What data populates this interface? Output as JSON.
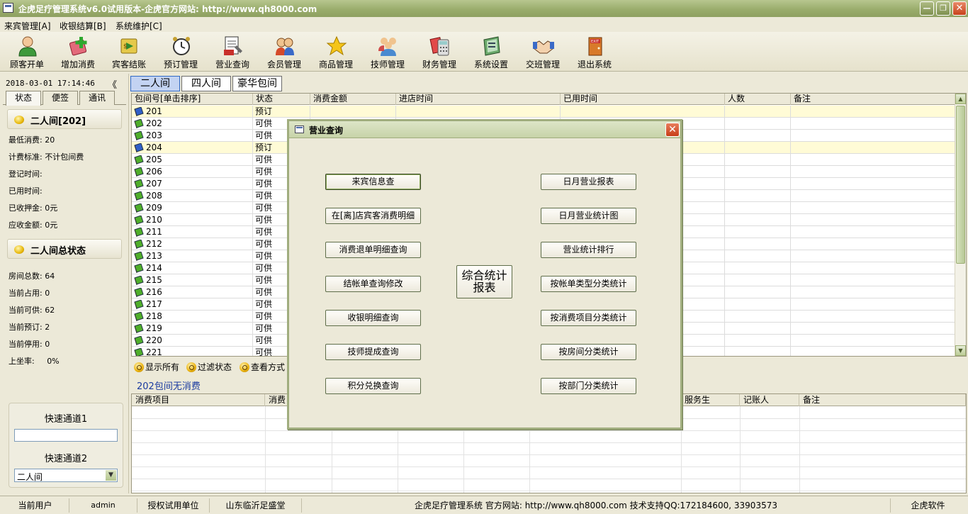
{
  "window": {
    "title": "企虎足疗管理系统v6.0试用版本-企虎官方网站: http://www.qh8000.com"
  },
  "menu": [
    "来宾管理[A]",
    "收银结算[B]",
    "系统维护[C]"
  ],
  "toolbar": [
    {
      "label": "顾客开单",
      "icon": "customer-icon"
    },
    {
      "label": "增加消费",
      "icon": "add-consume-icon"
    },
    {
      "label": "宾客结账",
      "icon": "checkout-icon"
    },
    {
      "label": "预订管理",
      "icon": "alarm-clock-icon"
    },
    {
      "label": "营业查询",
      "icon": "business-query-icon"
    },
    {
      "label": "会员管理",
      "icon": "members-icon"
    },
    {
      "label": "商品管理",
      "icon": "star-icon"
    },
    {
      "label": "技师管理",
      "icon": "technicians-icon"
    },
    {
      "label": "财务管理",
      "icon": "finance-icon"
    },
    {
      "label": "系统设置",
      "icon": "settings-icon"
    },
    {
      "label": "交班管理",
      "icon": "handshake-icon"
    },
    {
      "label": "退出系统",
      "icon": "exit-door-icon"
    }
  ],
  "left": {
    "datetime": "2018-03-01 17:14:46",
    "collapse": "《",
    "tabs": [
      "状态",
      "便签",
      "通讯"
    ],
    "room_section_title": "二人间[202]",
    "room_info": [
      "最低消费: 20",
      "计费标准: 不计包间费",
      "登记时间:",
      "已用时间:",
      "已收押金: 0元",
      "应收金额: 0元"
    ],
    "summary_title": "二人间总状态",
    "summary": [
      "房间总数: 64",
      "当前占用: 0",
      "当前可供: 62",
      "当前预订: 2",
      "当前停用: 0",
      "上坐率:     0%"
    ],
    "quick1_label": "快速通道1",
    "quick1_value": "",
    "quick2_label": "快速通道2",
    "quick2_value": "二人间"
  },
  "room_tabs": [
    "二人间",
    "四人间",
    "豪华包间"
  ],
  "room_grid": {
    "headers": [
      "包间号[单击排序]",
      "状态",
      "消费金额",
      "进店时间",
      "已用时间",
      "人数",
      "备注"
    ],
    "rows": [
      {
        "room": "201",
        "status": "预订",
        "booked": true
      },
      {
        "room": "202",
        "status": "可供",
        "booked": false
      },
      {
        "room": "203",
        "status": "可供",
        "booked": false
      },
      {
        "room": "204",
        "status": "预订",
        "booked": true
      },
      {
        "room": "205",
        "status": "可供",
        "booked": false
      },
      {
        "room": "206",
        "status": "可供",
        "booked": false
      },
      {
        "room": "207",
        "status": "可供",
        "booked": false
      },
      {
        "room": "208",
        "status": "可供",
        "booked": false
      },
      {
        "room": "209",
        "status": "可供",
        "booked": false
      },
      {
        "room": "210",
        "status": "可供",
        "booked": false
      },
      {
        "room": "211",
        "status": "可供",
        "booked": false
      },
      {
        "room": "212",
        "status": "可供",
        "booked": false
      },
      {
        "room": "213",
        "status": "可供",
        "booked": false
      },
      {
        "room": "214",
        "status": "可供",
        "booked": false
      },
      {
        "room": "215",
        "status": "可供",
        "booked": false
      },
      {
        "room": "216",
        "status": "可供",
        "booked": false
      },
      {
        "room": "217",
        "status": "可供",
        "booked": false
      },
      {
        "room": "218",
        "status": "可供",
        "booked": false
      },
      {
        "room": "219",
        "status": "可供",
        "booked": false
      },
      {
        "room": "220",
        "status": "可供",
        "booked": false
      },
      {
        "room": "221",
        "status": "可供",
        "booked": false
      }
    ]
  },
  "filters": [
    "显示所有",
    "过滤状态",
    "查看方式"
  ],
  "no_consume_text": "202包间无消费",
  "consume_grid": {
    "headers": [
      "消费项目",
      "消费",
      "服务生",
      "记账人",
      "备注"
    ]
  },
  "dialog": {
    "title": "营业查询",
    "left_buttons": [
      "来宾信息查",
      "在[离]店宾客消费明细",
      "消费退单明细查询",
      "结帐单查询修改",
      "收银明细查询",
      "技师提成查询",
      "积分兑换查询"
    ],
    "right_buttons": [
      "日月营业报表",
      "日月营业统计图",
      "营业统计排行",
      "按帐单类型分类统计",
      "按消费项目分类统计",
      "按房间分类统计",
      "按部门分类统计"
    ],
    "center_button": "综合统计报表"
  },
  "statusbar": {
    "user_label": "当前用户",
    "user": "admin",
    "license_label": "授权试用单位",
    "company": "山东临沂足盛堂",
    "info": "企虎足疗管理系统 官方网站: http://www.qh8000.com 技术支持QQ:172184600, 33903573",
    "brand": "企虎软件"
  },
  "colors": {
    "titlebar": "#9aad6c",
    "booked_row": "#fffbd6",
    "active_tab": "#c3d3f2",
    "link_text": "#1a3aa0"
  }
}
